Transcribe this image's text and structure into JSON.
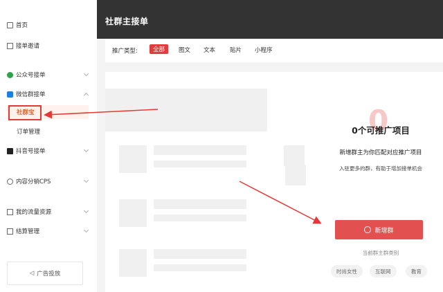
{
  "sidebar": {
    "items": [
      {
        "label": "首页",
        "icon": "home-icon"
      },
      {
        "label": "接单邀请",
        "icon": "document-icon"
      },
      {
        "label": "公众号接单",
        "icon": "wechat-official-icon"
      },
      {
        "label": "微信群接单",
        "icon": "wechat-group-icon"
      },
      {
        "label": "抖音号接单",
        "icon": "douyin-icon"
      },
      {
        "label": "内容分销CPS",
        "icon": "share-icon"
      },
      {
        "label": "我的流量资源",
        "icon": "resource-icon"
      },
      {
        "label": "结算管理",
        "icon": "settlement-icon"
      }
    ],
    "sub_items": [
      {
        "label": "社群宝"
      },
      {
        "label": "订单管理"
      }
    ],
    "ad_button": "广告投放"
  },
  "header": {
    "title": "社群主接单"
  },
  "filter": {
    "label": "推广类型:",
    "tabs": [
      "全部",
      "图文",
      "文本",
      "贴片",
      "小程序"
    ]
  },
  "empty_state": {
    "count": "0",
    "title": "0个可推广项目",
    "description": "新增群主为你匹配对应推广项目",
    "subtitle": "入驻更多的群，有助于增加接单机会",
    "button": "新增群",
    "hint": "当前群主群类别",
    "tags": [
      "时尚女性",
      "互联网",
      "教育"
    ]
  },
  "colors": {
    "accent": "#e23c3c",
    "annotation": "#e53935"
  }
}
